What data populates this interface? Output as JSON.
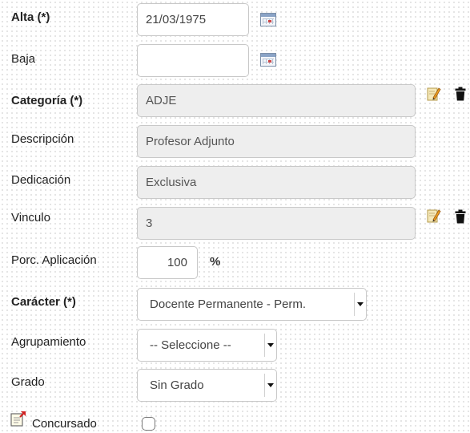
{
  "fields": {
    "alta": {
      "label": "Alta (*)",
      "value": "21/03/1975"
    },
    "baja": {
      "label": "Baja",
      "value": ""
    },
    "categoria": {
      "label": "Categoría (*)",
      "value": "ADJE"
    },
    "descripcion": {
      "label": "Descripción",
      "value": "Profesor Adjunto"
    },
    "dedicacion": {
      "label": "Dedicación",
      "value": "Exclusiva"
    },
    "vinculo": {
      "label": "Vinculo",
      "value": "3"
    },
    "porc_aplicacion": {
      "label": "Porc. Aplicación",
      "value": "100",
      "unit": "%"
    },
    "caracter": {
      "label": "Carácter (*)",
      "selected": "Docente Permanente - Perm."
    },
    "agrupamiento": {
      "label": "Agrupamiento",
      "selected": "-- Seleccione --"
    },
    "grado": {
      "label": "Grado",
      "selected": "Sin Grado"
    },
    "concursado": {
      "label": "Concursado",
      "checked": false
    }
  },
  "icons": {
    "calendar": "calendar-icon",
    "edit": "pencil-edit-icon",
    "delete": "trash-icon",
    "note": "note-icon"
  }
}
